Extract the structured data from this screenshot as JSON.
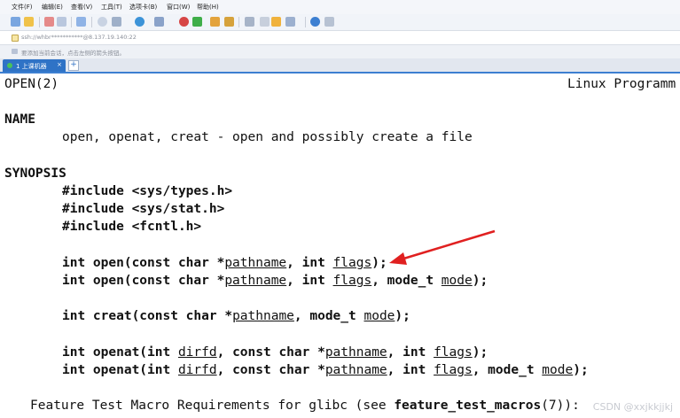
{
  "menubar": [
    "文件(F)",
    "编辑(E)",
    "查看(V)",
    "工具(T)",
    "选项卡(B)",
    "窗口(W)",
    "帮助(H)"
  ],
  "address": {
    "text": "ssh://whbr***********@8.137.19.140:22"
  },
  "infobar": {
    "text": "要添加当前会话，点击左侧的箭头按钮。"
  },
  "tab": {
    "label": "1 上课机器",
    "close": "×",
    "new": "+"
  },
  "terminal": {
    "header_left": "OPEN(2)",
    "header_right": "Linux Programm",
    "name_heading": "NAME",
    "name_desc": "open, openat, creat - open and possibly create a file",
    "synopsis_heading": "SYNOPSIS",
    "includes": [
      "#include <sys/types.h>",
      "#include <sys/stat.h>",
      "#include <fcntl.h>"
    ],
    "open1": {
      "a": "int open(const char *",
      "p": "pathname",
      "b": ", int ",
      "f": "flags",
      "c": ");"
    },
    "open2": {
      "a": "int open(const char *",
      "p": "pathname",
      "b": ", int ",
      "f": "flags",
      "c": ", mode_t ",
      "m": "mode",
      "d": ");"
    },
    "creat": {
      "a": "int creat(const char *",
      "p": "pathname",
      "b": ", mode_t ",
      "m": "mode",
      "c": ");"
    },
    "openat1": {
      "a": "int openat(int ",
      "d": "dirfd",
      "b": ", const char *",
      "p": "pathname",
      "c": ", int ",
      "f": "flags",
      "e": ");"
    },
    "openat2": {
      "a": "int openat(int ",
      "d": "dirfd",
      "b": ", const char *",
      "p": "pathname",
      "c": ", int ",
      "f": "flags",
      "g": ", mode_t ",
      "m": "mode",
      "e": ");"
    },
    "feature": {
      "a": "Feature Test Macro Requirements for glibc (see ",
      "b": "feature_test_macros",
      "c": "(7)):"
    }
  },
  "watermark": "CSDN @xxjkkjjkj",
  "colors": {
    "arrow": "#e02020",
    "tab": "#2f73c6"
  }
}
